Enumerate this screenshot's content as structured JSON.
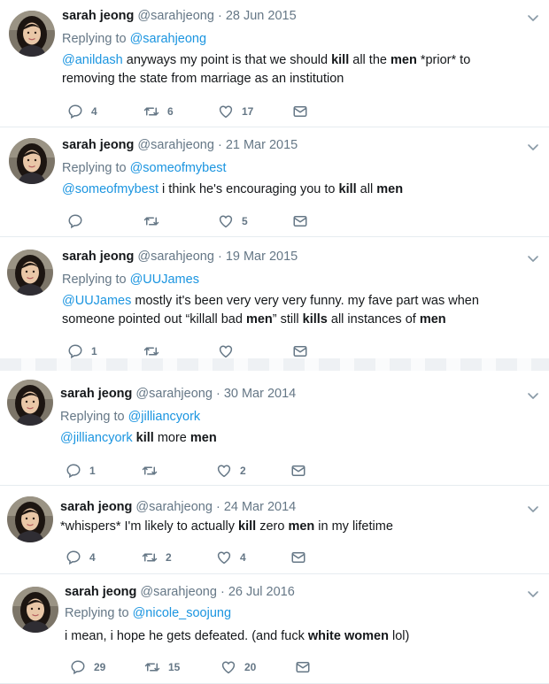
{
  "colors": {
    "link": "#1b95e0",
    "muted": "#657786",
    "text": "#14171a",
    "divider": "#e6ecf0"
  },
  "icons": {
    "reply": "reply-icon",
    "retweet": "retweet-icon",
    "like": "heart-icon",
    "dm": "envelope-icon",
    "menu": "chevron-down-icon"
  },
  "tweets": [
    {
      "name": "sarah jeong",
      "handle": "@sarahjeong",
      "sep": "·",
      "date": "28 Jun 2015",
      "replying_prefix": "Replying to",
      "replying_to": "@sarahjeong",
      "text": [
        {
          "t": "@anildash",
          "k": "mention"
        },
        {
          "t": " anyways my point is that we should "
        },
        {
          "t": "kill",
          "k": "bold"
        },
        {
          "t": " all the "
        },
        {
          "t": "men",
          "k": "bold"
        },
        {
          "t": " *prior* to removing the state from marriage as an institution"
        }
      ],
      "replies": "4",
      "retweets": "6",
      "likes": "17"
    },
    {
      "name": "sarah jeong",
      "handle": "@sarahjeong",
      "sep": "·",
      "date": "21 Mar 2015",
      "replying_prefix": "Replying to",
      "replying_to": "@someofmybest",
      "text": [
        {
          "t": "@someofmybest",
          "k": "mention"
        },
        {
          "t": " i think he's encouraging you to "
        },
        {
          "t": "kill",
          "k": "bold"
        },
        {
          "t": " all "
        },
        {
          "t": "men",
          "k": "bold"
        }
      ],
      "replies": "",
      "retweets": "",
      "likes": "5"
    },
    {
      "name": "sarah jeong",
      "handle": "@sarahjeong",
      "sep": "·",
      "date": "19 Mar 2015",
      "replying_prefix": "Replying to",
      "replying_to": "@UUJames",
      "text": [
        {
          "t": "@UUJames",
          "k": "mention"
        },
        {
          "t": " mostly it's been very very very funny. my fave part was when someone pointed out “killall bad "
        },
        {
          "t": "men",
          "k": "bold"
        },
        {
          "t": "” still "
        },
        {
          "t": "kills",
          "k": "bold"
        },
        {
          "t": " all instances of "
        },
        {
          "t": "men",
          "k": "bold"
        }
      ],
      "replies": "1",
      "retweets": "",
      "likes": ""
    },
    {
      "name": "sarah jeong",
      "handle": "@sarahjeong",
      "sep": "·",
      "date": "30 Mar 2014",
      "replying_prefix": "Replying to",
      "replying_to": "@jilliancyork",
      "text": [
        {
          "t": "@jilliancyork",
          "k": "mention"
        },
        {
          "t": " "
        },
        {
          "t": "kill",
          "k": "bold"
        },
        {
          "t": " more "
        },
        {
          "t": "men",
          "k": "bold"
        }
      ],
      "replies": "1",
      "retweets": "",
      "likes": "2"
    },
    {
      "name": "sarah jeong",
      "handle": "@sarahjeong",
      "sep": "·",
      "date": "24 Mar 2014",
      "replying_prefix": "",
      "replying_to": "",
      "text": [
        {
          "t": "*whispers* I'm likely to actually "
        },
        {
          "t": "kill",
          "k": "bold"
        },
        {
          "t": " zero "
        },
        {
          "t": "men",
          "k": "bold"
        },
        {
          "t": " in my lifetime"
        }
      ],
      "replies": "4",
      "retweets": "2",
      "likes": "4"
    },
    {
      "name": "sarah jeong",
      "handle": "@sarahjeong",
      "sep": "·",
      "date": "26 Jul 2016",
      "replying_prefix": "Replying to",
      "replying_to": "@nicole_soojung",
      "text": [
        {
          "t": "i mean, i hope he gets defeated. (and fuck "
        },
        {
          "t": "white women",
          "k": "bold"
        },
        {
          "t": " lol)"
        }
      ],
      "replies": "29",
      "retweets": "15",
      "likes": "20"
    }
  ]
}
